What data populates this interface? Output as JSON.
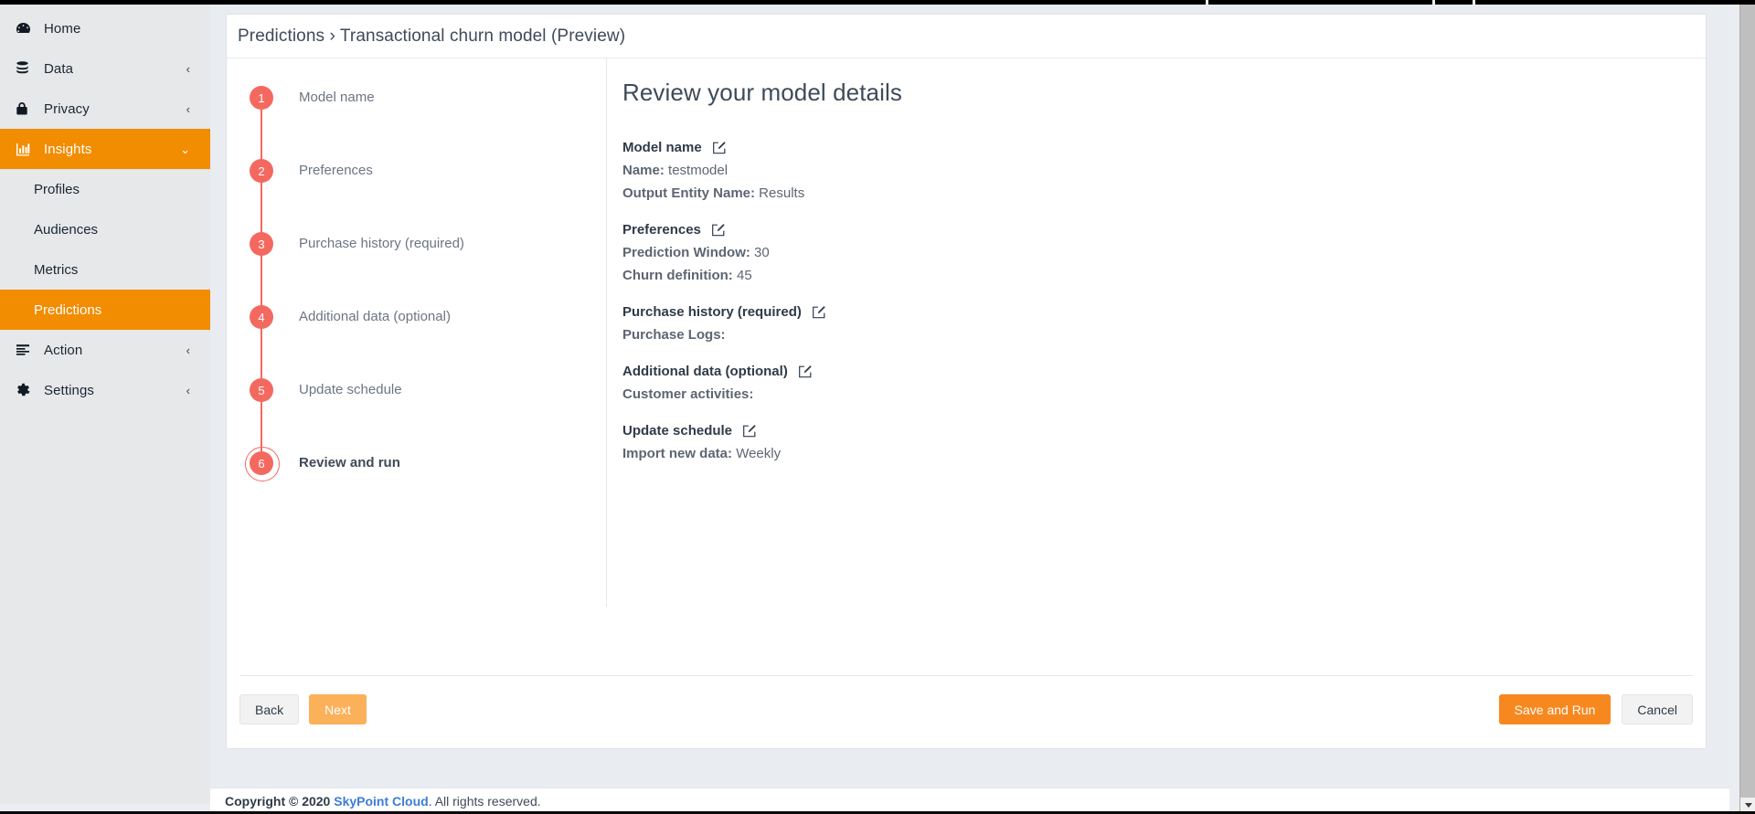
{
  "sidebar": {
    "items": [
      {
        "label": "Home",
        "icon": "dashboard-icon",
        "chevron": "",
        "active": false
      },
      {
        "label": "Data",
        "icon": "database-icon",
        "chevron": "‹",
        "active": false
      },
      {
        "label": "Privacy",
        "icon": "lock-icon",
        "chevron": "‹",
        "active": false
      },
      {
        "label": "Insights",
        "icon": "bar-chart-icon",
        "chevron": "⌄",
        "active": true
      },
      {
        "label": "Action",
        "icon": "list-icon",
        "chevron": "‹",
        "active": false
      },
      {
        "label": "Settings",
        "icon": "gear-icon",
        "chevron": "‹",
        "active": false
      }
    ],
    "sub_items": [
      {
        "label": "Profiles",
        "active": false
      },
      {
        "label": "Audiences",
        "active": false
      },
      {
        "label": "Metrics",
        "active": false
      },
      {
        "label": "Predictions",
        "active": true
      }
    ],
    "accent_color": "#f28c00",
    "background_color": "#e6e8ea"
  },
  "breadcrumb": {
    "root": "Predictions",
    "separator": "›",
    "current": "Transactional churn model (Preview)",
    "full": "Predictions › Transactional churn model (Preview)"
  },
  "stepper": {
    "steps": [
      {
        "number": "1",
        "label": "Model name",
        "current": false
      },
      {
        "number": "2",
        "label": "Preferences",
        "current": false
      },
      {
        "number": "3",
        "label": "Purchase history (required)",
        "current": false
      },
      {
        "number": "4",
        "label": "Additional data (optional)",
        "current": false
      },
      {
        "number": "5",
        "label": "Update schedule",
        "current": false
      },
      {
        "number": "6",
        "label": "Review and run",
        "current": true
      }
    ],
    "bullet_color": "#f4695f"
  },
  "review": {
    "title": "Review your model details",
    "edit_icon": "edit-pencil-icon",
    "sections": [
      {
        "heading": "Model name",
        "lines": [
          {
            "key": "Name:",
            "value": "testmodel"
          },
          {
            "key": "Output Entity Name:",
            "value": "Results"
          }
        ]
      },
      {
        "heading": "Preferences",
        "lines": [
          {
            "key": "Prediction Window:",
            "value": "30"
          },
          {
            "key": "Churn definition:",
            "value": "45"
          }
        ]
      },
      {
        "heading": "Purchase history (required)",
        "lines": [
          {
            "key": "Purchase Logs:",
            "value": ""
          }
        ]
      },
      {
        "heading": "Additional data (optional)",
        "lines": [
          {
            "key": "Customer activities:",
            "value": ""
          }
        ]
      },
      {
        "heading": "Update schedule",
        "lines": [
          {
            "key": "Import new data:",
            "value": "Weekly"
          }
        ]
      }
    ]
  },
  "footer_buttons": {
    "back": "Back",
    "next": "Next",
    "save_and_run": "Save and Run",
    "cancel": "Cancel",
    "save_color": "#f7881f",
    "next_color": "#fbb05a"
  },
  "page_footer": {
    "copyright": "Copyright © 2020",
    "brand": "SkyPoint Cloud",
    "rest": ". All rights reserved."
  }
}
